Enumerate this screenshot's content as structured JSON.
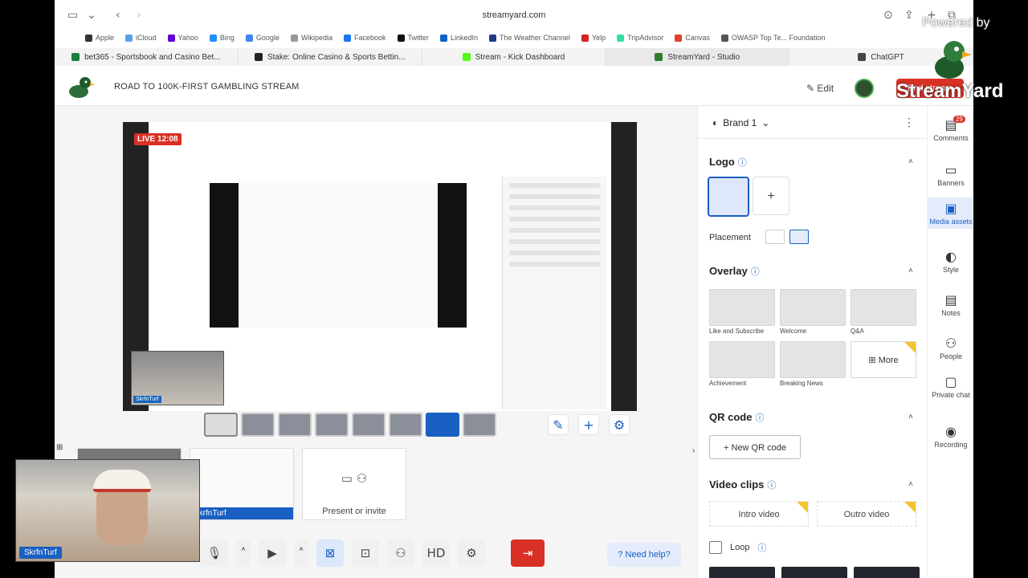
{
  "browser": {
    "url": "streamyard.com",
    "bookmarks": [
      "Apple",
      "iCloud",
      "Yahoo",
      "Bing",
      "Google",
      "Wikipedia",
      "Facebook",
      "Twitter",
      "LinkedIn",
      "The Weather Channel",
      "Yelp",
      "TripAdvisor",
      "Canvas",
      "OWASP Top Te... Foundation"
    ],
    "tabs": [
      {
        "label": "bet365 - Sportsbook and Casino Bet...",
        "color": "#1b7f3a"
      },
      {
        "label": "Stake: Online Casino & Sports Bettin...",
        "color": "#222222"
      },
      {
        "label": "Stream - Kick Dashboard",
        "color": "#53fc18"
      },
      {
        "label": "StreamYard - Studio",
        "color": "#2e7d32"
      },
      {
        "label": "ChatGPT",
        "color": "#444444"
      }
    ]
  },
  "header": {
    "title": "ROAD TO 100K-FIRST GAMBLING STREAM",
    "edit_label": "Edit",
    "end_stream_label": "End stream"
  },
  "stage": {
    "live_label": "LIVE 12:08",
    "cam_name": "SkrfnTurf"
  },
  "guests": {
    "present_label": "Present or invite",
    "cam_name": "SkrfnTurf"
  },
  "controls": {
    "need_help": "Need help?"
  },
  "panel": {
    "brand": "Brand 1",
    "logo_title": "Logo",
    "placement_label": "Placement",
    "overlay_title": "Overlay",
    "overlays": [
      "Like and Subscribe",
      "Welcome",
      "Q&A",
      "Achievement",
      "Breaking News"
    ],
    "more_label": "More",
    "qr_title": "QR code",
    "qr_button": "New QR code",
    "video_title": "Video clips",
    "intro": "Intro video",
    "outro": "Outro video",
    "loop": "Loop"
  },
  "nav": {
    "items": [
      {
        "label": "Comments",
        "icon": "comment-icon",
        "badge": "29"
      },
      {
        "label": "Banners",
        "icon": "banner-icon"
      },
      {
        "label": "Media assets",
        "icon": "media-icon"
      },
      {
        "label": "Style",
        "icon": "palette-icon"
      },
      {
        "label": "Notes",
        "icon": "notes-icon"
      },
      {
        "label": "People",
        "icon": "people-icon"
      },
      {
        "label": "Private chat",
        "icon": "chat-icon"
      },
      {
        "label": "Recording",
        "icon": "record-icon"
      }
    ]
  },
  "overlays_outside": {
    "webcam_name": "SkrfnTurf",
    "powered_by": "Powered by",
    "brand_logo": "StreamYard"
  }
}
